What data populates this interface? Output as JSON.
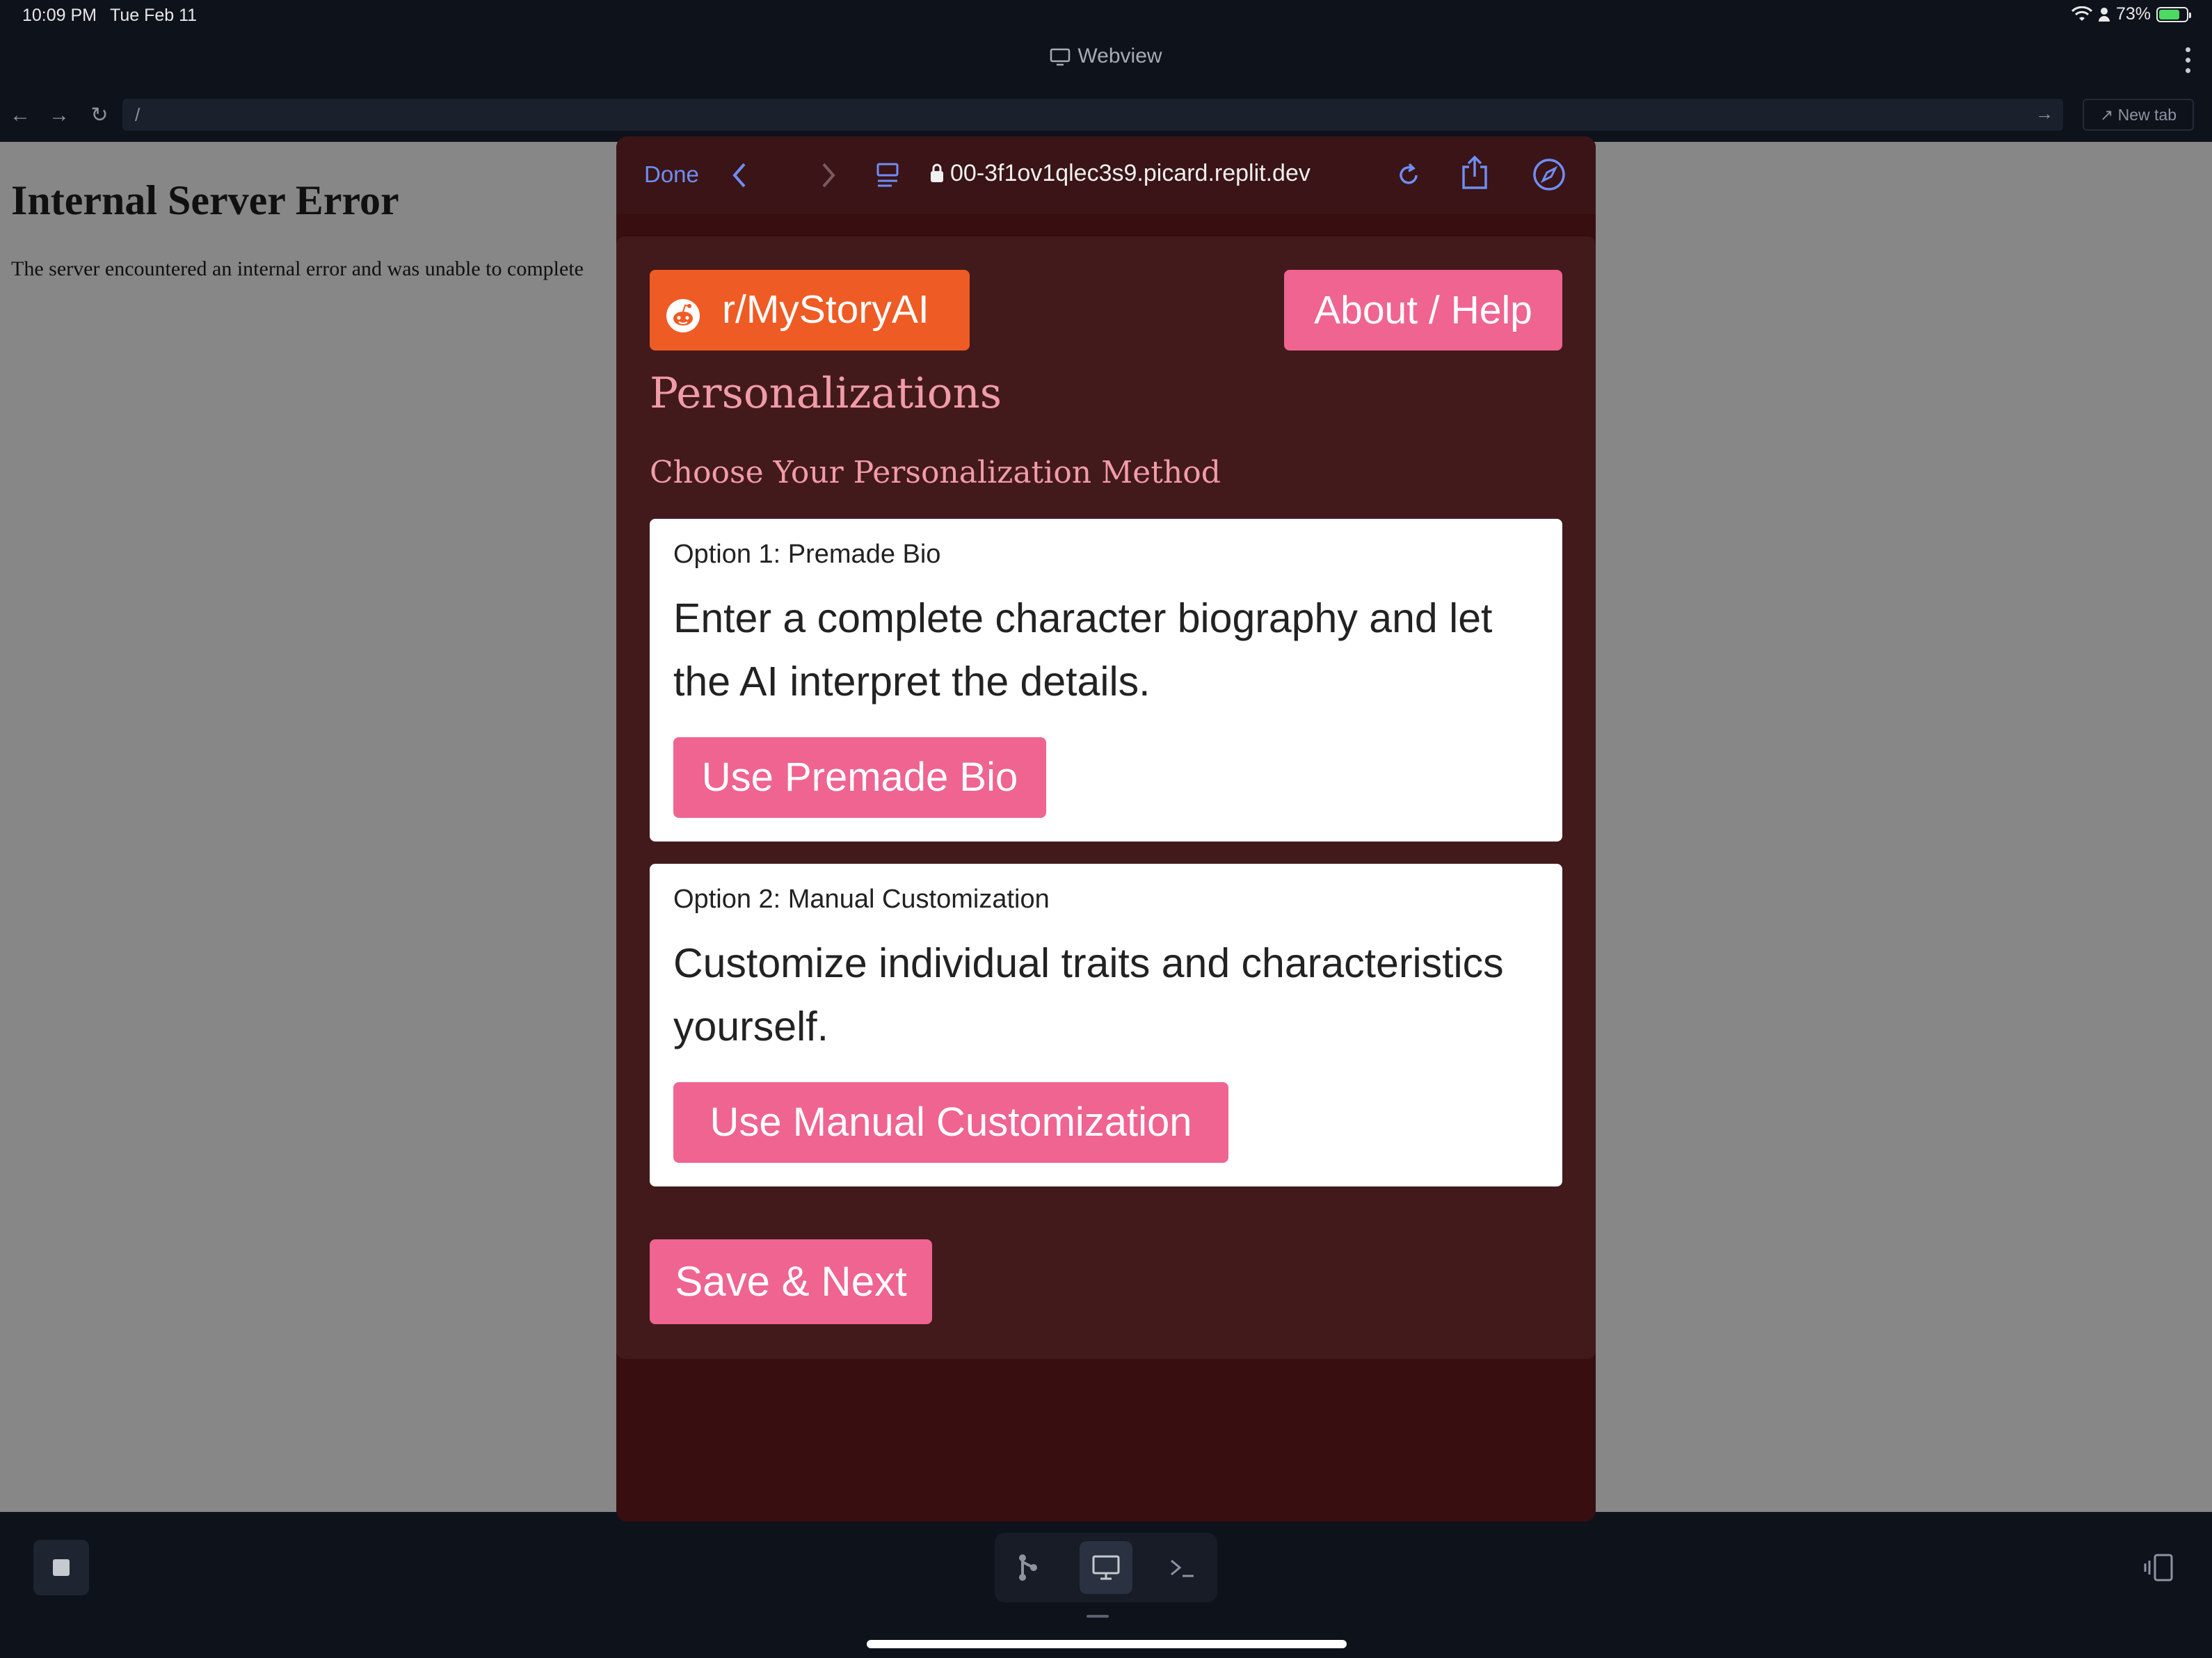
{
  "status_bar": {
    "time": "10:09 PM",
    "date": "Tue Feb 11",
    "battery": "73%"
  },
  "webview": {
    "title": "Webview",
    "url": "/",
    "new_tab_label": "New tab"
  },
  "behind_page": {
    "title": "Internal Server Error",
    "message": "The server encountered an internal error and was unable to complete"
  },
  "safari": {
    "done_label": "Done",
    "url": "00-3f1ov1qlec3s9.picard.replit.dev"
  },
  "app": {
    "subreddit_label": "r/MyStoryAI",
    "about_label": "About / Help",
    "heading": "Personalizations",
    "subheading": "Choose Your Personalization Method",
    "options": [
      {
        "label": "Option 1: Premade Bio",
        "description": "Enter a complete character biography and let the AI interpret the details.",
        "button": "Use Premade Bio"
      },
      {
        "label": "Option 2: Manual Customization",
        "description": "Customize individual traits and characteristics yourself.",
        "button": "Use Manual Customization"
      }
    ],
    "save_label": "Save & Next"
  },
  "colors": {
    "reddit_orange": "#ef5b24",
    "accent_pink": "#ef6491",
    "heading_pink": "#f29ba8",
    "panel_bg": "#421a1c",
    "modal_bg": "#380e10"
  },
  "icons": [
    "wifi-icon",
    "person-icon",
    "battery-icon",
    "monitor-icon",
    "kebab-icon",
    "back-arrow-icon",
    "forward-arrow-icon",
    "reload-icon",
    "external-link-icon",
    "chevron-left-icon",
    "chevron-right-icon",
    "reader-icon",
    "lock-icon",
    "refresh-icon",
    "share-icon",
    "compass-icon",
    "reddit-icon",
    "stop-icon",
    "git-icon",
    "terminal-icon",
    "side-panel-icon"
  ]
}
